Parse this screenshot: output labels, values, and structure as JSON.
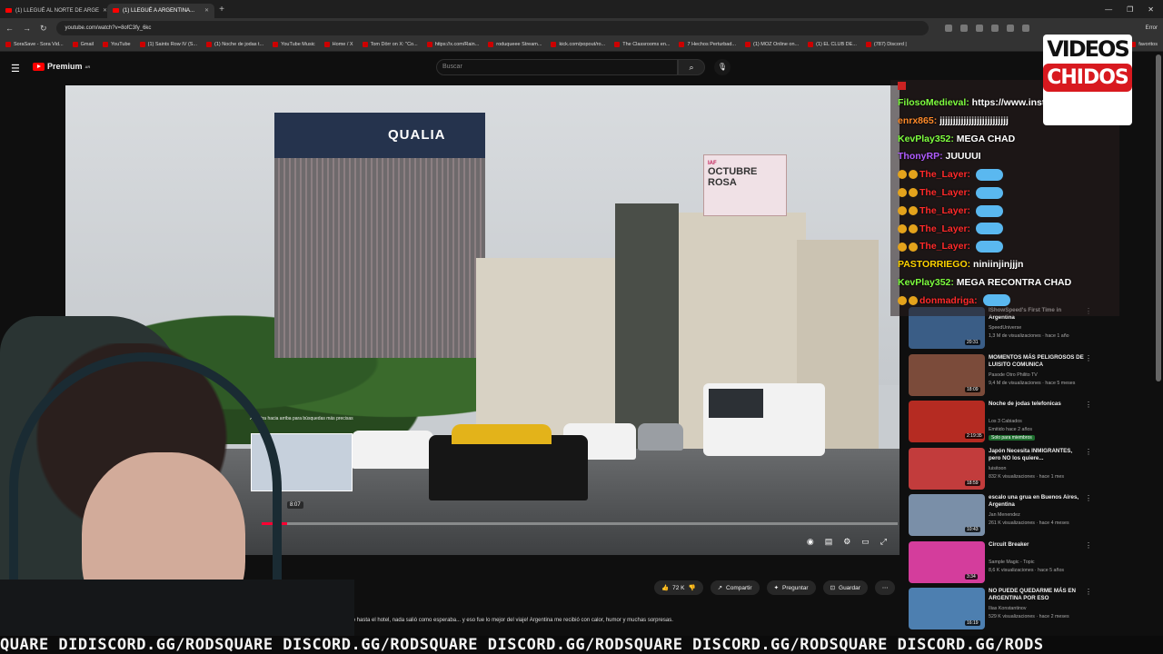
{
  "browser": {
    "tabs": [
      {
        "label": "(1) LLEGUÉ AL NORTE DE ARGE",
        "active": false
      },
      {
        "label": "(1) LLEGUÉ A ARGENTINA...",
        "active": true
      }
    ],
    "url": "youtube.com/watch?v=8ofC3fy_6kc",
    "error_label": "Error",
    "bookmarks": [
      "SoraSave - Sora Vid...",
      "Gmail",
      "YouTube",
      "(1) Saints Row IV (S...",
      "(1) Noche de jodas t...",
      "YouTube Music",
      "Home / X",
      "Tom Dörr on X: \"Co...",
      "https://x.com/Rain...",
      "roduqueee Stream...",
      "kick.com/popout/ro...",
      "The Classrooms en...",
      "7 Hechos Perturbad...",
      "(1) MOZ Online on...",
      "(1) EL CLUB DE...",
      "(787) Discord |",
      "favoritos"
    ]
  },
  "youtube": {
    "logo_text": "Premium",
    "logo_region": "AR",
    "search_placeholder": "Buscar"
  },
  "video": {
    "sign_text": "QUALIA",
    "billboard_top": "IAF",
    "billboard_main": "OCTUBRE ROSA",
    "preview_label": "Arrastra hacia arriba para búsquedas más precisas",
    "preview_time": "8:07",
    "progress_fraction": 0.04
  },
  "actions": {
    "likes": "72 K",
    "share": "Compartir",
    "ask": "Preguntar",
    "save": "Guardar"
  },
  "description": "to hasta el hotel, nada salió como esperaba... y eso fue lo mejor del viaje! Argentina me recibió con calor, humor y muchas sorpresas.",
  "chat": [
    {
      "user": "FilosoMedieval:",
      "msg": "https://www.insta",
      "color": "#7fff3f",
      "emoji": false
    },
    {
      "user": "enrx865:",
      "msg": "jjjjjjjjjjjjjjjjjjjjjjjjjj",
      "color": "#ff8a2a",
      "emoji": false
    },
    {
      "user": "KevPlay352:",
      "msg": "MEGA CHAD",
      "color": "#7fff3f",
      "emoji": false
    },
    {
      "user": "ThonyRP:",
      "msg": "JUUUUI",
      "color": "#b05cff",
      "emoji": false
    },
    {
      "user": "The_Layer:",
      "msg": "",
      "color": "#ff2a2a",
      "emoji": true
    },
    {
      "user": "The_Layer:",
      "msg": "",
      "color": "#ff2a2a",
      "emoji": true
    },
    {
      "user": "The_Layer:",
      "msg": "",
      "color": "#ff2a2a",
      "emoji": true
    },
    {
      "user": "The_Layer:",
      "msg": "",
      "color": "#ff2a2a",
      "emoji": true
    },
    {
      "user": "The_Layer:",
      "msg": "",
      "color": "#ff2a2a",
      "emoji": true
    },
    {
      "user": "PASTORRIEGO:",
      "msg": "niniinjinjjjn",
      "color": "#ffd400",
      "emoji": false
    },
    {
      "user": "KevPlay352:",
      "msg": "MEGA RECONTRA CHAD",
      "color": "#7fff3f",
      "emoji": false
    },
    {
      "user": "donmadriga:",
      "msg": "",
      "color": "#ff2a2a",
      "emoji": true
    }
  ],
  "brand_logo": {
    "line1": "VIDEOS",
    "line2": "CHIDOS"
  },
  "recs": [
    {
      "title": "IShowSpeed's First Time in Argentina",
      "channel": "SpeedUniverse",
      "meta": "1,3 M de visualizaciones · hace 1 año",
      "duration": "20:31",
      "color": "#3a5d86",
      "members": ""
    },
    {
      "title": "MOMENTOS MÁS PELIGROSOS DE LUISITO COMUNICA",
      "channel": "Pasode Otro Philito TV",
      "meta": "9,4 M de visualizaciones · hace 5 meses",
      "duration": "18:09",
      "color": "#7b4b3a",
      "members": ""
    },
    {
      "title": "Noche de jodas telefonicas",
      "channel": "Los 3 Cabiados",
      "meta": "Emitido hace 2 años",
      "duration": "2:19:35",
      "color": "#b52b22",
      "members": "Solo para miembros"
    },
    {
      "title": "Japón Necesita INMIGRANTES, pero NO los quiere...",
      "channel": "luisitoon",
      "meta": "832 K visualizaciones · hace 1 mes",
      "duration": "18:59",
      "color": "#c23c3c",
      "members": ""
    },
    {
      "title": "escalo una grua en Buenos Aires, Argentina",
      "channel": "Jan Menendez",
      "meta": "261 K visualizaciones · hace 4 meses",
      "duration": "10:43",
      "color": "#7a8fa8",
      "members": ""
    },
    {
      "title": "Circuit Breaker",
      "channel": "Sample Magic - Topic",
      "meta": "8,6 K visualizaciones · hace 5 años",
      "duration": "3:34",
      "color": "#d43d9c",
      "members": ""
    },
    {
      "title": "NO PUEDE QUEDARME MÁS EN ARGENTINA POR ESO",
      "channel": "Ilias Konstantinov",
      "meta": "529 K visualizaciones · hace 2 meses",
      "duration": "16:19",
      "color": "#4d7fb0",
      "members": ""
    }
  ],
  "ticker": "QUARE DIDISCORD.GG/RODSQUARE DISCORD.GG/RODSQUARE DISCORD.GG/RODSQUARE DISCORD.GG/RODSQUARE DISCORD.GG/RODS"
}
